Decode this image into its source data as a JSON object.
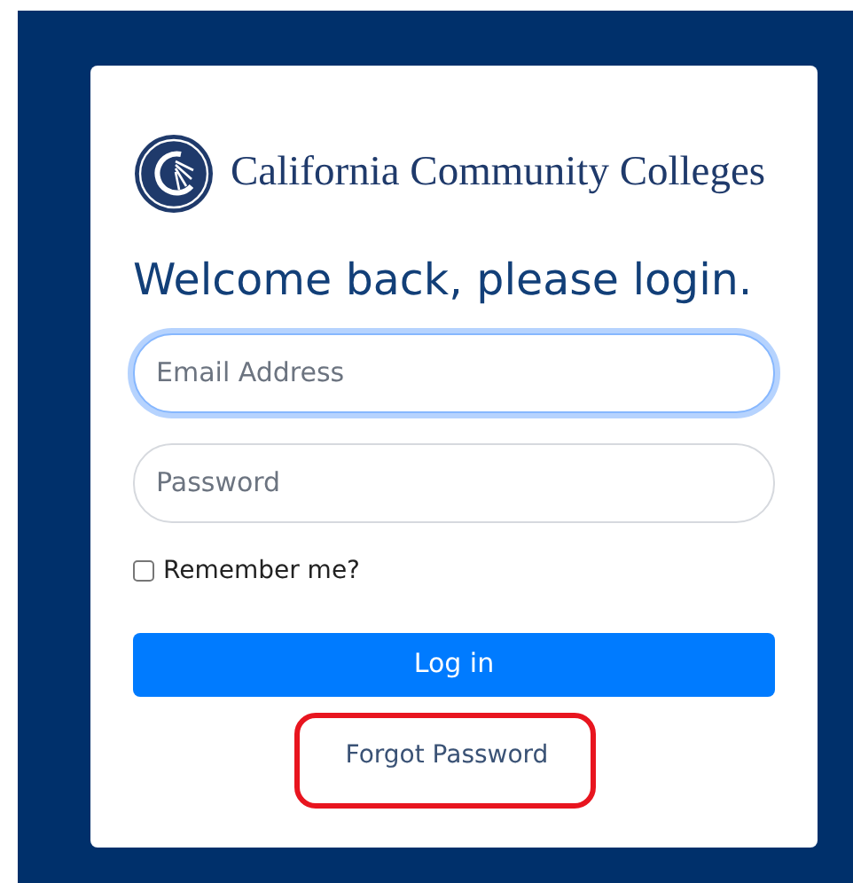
{
  "brand": {
    "name": "California Community Colleges"
  },
  "heading": "Welcome back, please login.",
  "fields": [
    {
      "placeholder": "Email Address",
      "focused": true
    },
    {
      "placeholder": "Password",
      "focused": false
    }
  ],
  "remember": {
    "label": "Remember me?",
    "checked": false
  },
  "login_button": "Log in",
  "forgot_password": {
    "label": "Forgot Password",
    "highlighted": true
  }
}
